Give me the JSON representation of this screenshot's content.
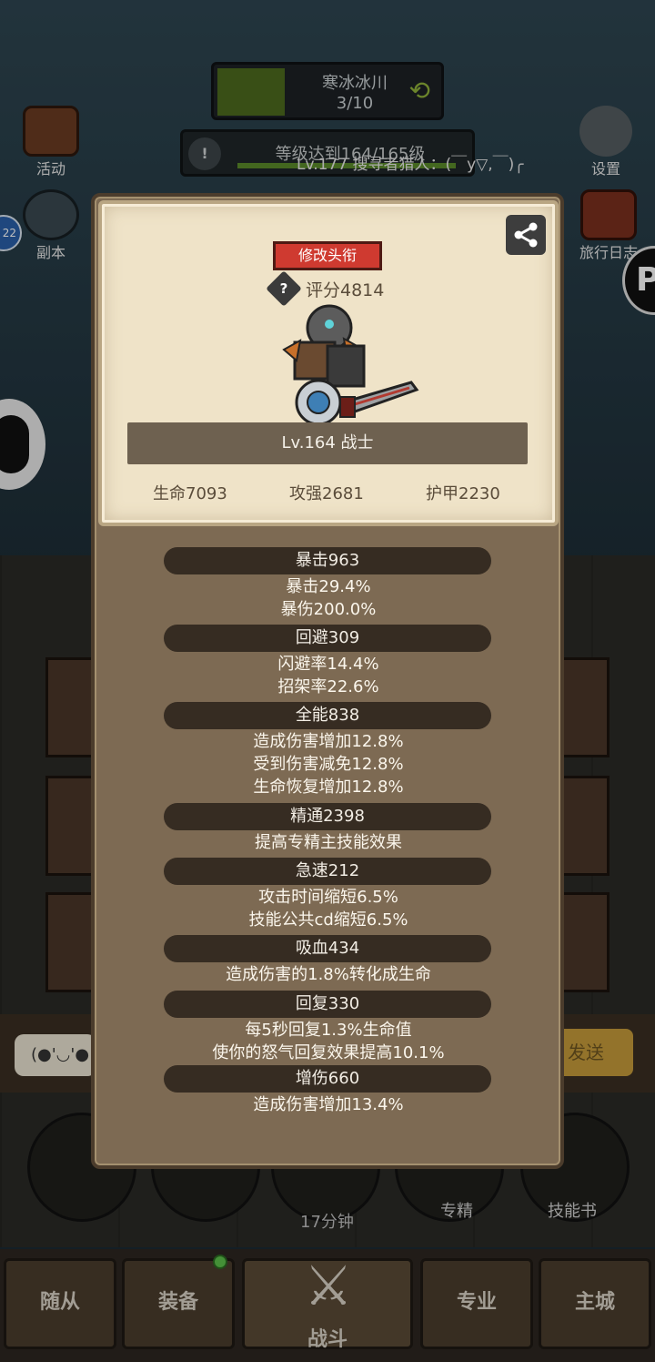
{
  "background": {
    "quest": {
      "title": "寒冰冰川",
      "count": "3/10"
    },
    "level_bar": {
      "text": "等级达到164/165级",
      "hunter_text": "Lv.177 搜寻者猎人：(￣y▽,￣)╭"
    },
    "side_left": [
      {
        "label": "活动",
        "icon": "calendar-icon"
      },
      {
        "label": "副本",
        "icon": "dungeon-icon"
      }
    ],
    "side_right": [
      {
        "label": "设置",
        "icon": "gear-icon"
      },
      {
        "label": "旅行日志",
        "icon": "journal-icon"
      }
    ],
    "left_badge": "22",
    "chat": {
      "input": "(●'◡'●",
      "send": "发送"
    },
    "round_buttons": [
      {
        "label": ""
      },
      {
        "label": ""
      },
      {
        "label": "17分钟"
      },
      {
        "label": "专精"
      },
      {
        "label": "技能书"
      }
    ],
    "nav": [
      {
        "label": "随从"
      },
      {
        "label": "装备"
      },
      {
        "label": "战斗"
      },
      {
        "label": "专业"
      },
      {
        "label": "主城"
      }
    ]
  },
  "profile": {
    "title_button": "修改头衔",
    "score": "评分4814",
    "level_class": "Lv.164 战士",
    "hp": "生命7093",
    "attack": "攻强2681",
    "armor": "护甲2230"
  },
  "stats": [
    {
      "header": "暴击963",
      "lines": [
        "暴击29.4%",
        "暴伤200.0%"
      ]
    },
    {
      "header": "回避309",
      "lines": [
        "闪避率14.4%",
        "招架率22.6%"
      ]
    },
    {
      "header": "全能838",
      "lines": [
        "造成伤害增加12.8%",
        "受到伤害减免12.8%",
        "生命恢复增加12.8%"
      ]
    },
    {
      "header": "精通2398",
      "lines": [
        "提高专精主技能效果"
      ]
    },
    {
      "header": "急速212",
      "lines": [
        "攻击时间缩短6.5%",
        "技能公共cd缩短6.5%"
      ]
    },
    {
      "header": "吸血434",
      "lines": [
        "造成伤害的1.8%转化成生命"
      ]
    },
    {
      "header": "回复330",
      "lines": [
        "每5秒回复1.3%生命值",
        "使你的怒气回复效果提高10.1%"
      ]
    },
    {
      "header": "增伤660",
      "lines": [
        "造成伤害增加13.4%"
      ]
    }
  ],
  "colors": {
    "panel": "#7d6a53",
    "card": "#efe3c8",
    "header_pill": "#362c22",
    "title_button": "#cf3a30"
  }
}
